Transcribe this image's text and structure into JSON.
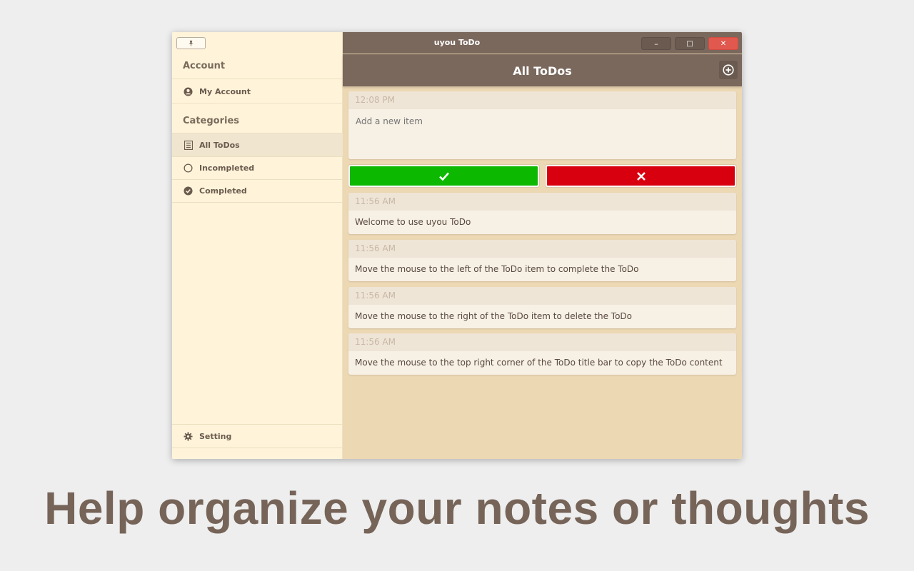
{
  "window": {
    "title": "uyou ToDo",
    "pin_icon": "pin-icon",
    "minimize_glyph": "–",
    "maximize_glyph": "□",
    "close_glyph": "✕"
  },
  "sidebar": {
    "account_title": "Account",
    "account_items": [
      {
        "label": "My Account",
        "icon": "user-circle-icon"
      }
    ],
    "categories_title": "Categories",
    "category_items": [
      {
        "label": "All ToDos",
        "icon": "list-icon",
        "active": true
      },
      {
        "label": "Incompleted",
        "icon": "circle-outline-icon",
        "active": false
      },
      {
        "label": "Completed",
        "icon": "check-circle-icon",
        "active": false
      }
    ],
    "setting": {
      "label": "Setting",
      "icon": "gear-icon"
    }
  },
  "main": {
    "header_title": "All ToDos",
    "add_icon": "plus-circle-icon",
    "new_item": {
      "time": "12:08 PM",
      "placeholder": "Add a new item"
    },
    "confirm_icon": "check-icon",
    "cancel_icon": "close-icon",
    "todos": [
      {
        "time": "11:56 AM",
        "text": "Welcome to use uyou ToDo"
      },
      {
        "time": "11:56 AM",
        "text": "Move the mouse to the left of the ToDo item to complete the ToDo"
      },
      {
        "time": "11:56 AM",
        "text": "Move the mouse to the right of the ToDo item to delete the ToDo"
      },
      {
        "time": "11:56 AM",
        "text": "Move the mouse to the top right corner of the ToDo title bar to copy the ToDo content"
      }
    ]
  },
  "tagline": "Help organize your notes or thoughts",
  "colors": {
    "titlebar": "#7a685d",
    "sidebar_bg": "#fff4da",
    "main_bg": "#edd8b4",
    "confirm": "#0cb800",
    "cancel": "#d8000f",
    "tagline": "#766459"
  }
}
